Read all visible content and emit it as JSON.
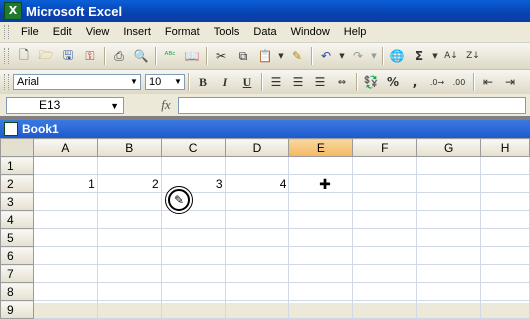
{
  "window": {
    "title": "Microsoft Excel",
    "app_icon": "excel-icon"
  },
  "menu": [
    "File",
    "Edit",
    "View",
    "Insert",
    "Format",
    "Tools",
    "Data",
    "Window",
    "Help"
  ],
  "toolbar_standard": [
    "new-icon",
    "open-icon",
    "save-icon",
    "permission-icon",
    "print-icon",
    "print-preview-icon",
    "spelling-icon",
    "cut-icon",
    "copy-icon",
    "paste-icon",
    "format-painter-icon",
    "undo-icon",
    "redo-icon",
    "hyperlink-icon",
    "autosum-icon",
    "sort-ascending-icon"
  ],
  "toolbar_formatting": {
    "font": "Arial",
    "size": "10",
    "buttons": [
      "bold-icon",
      "italic-icon",
      "underline-icon",
      "align-left-icon",
      "center-icon",
      "align-right-icon",
      "merge-center-icon",
      "currency-icon",
      "percent-icon",
      "comma-icon",
      "increase-decimal-icon",
      "decrease-indent-icon",
      "increase-indent-icon"
    ]
  },
  "formula_bar": {
    "name_box": "E13",
    "fx": "fx",
    "formula": ""
  },
  "workbook": {
    "title": "Book1"
  },
  "sheet": {
    "columns": [
      "A",
      "B",
      "C",
      "D",
      "E",
      "F",
      "G",
      "H"
    ],
    "selected_column": "E",
    "rows": [
      {
        "num": "1",
        "cells": [
          "",
          "",
          "",
          "",
          "",
          "",
          "",
          ""
        ]
      },
      {
        "num": "2",
        "cells": [
          "1",
          "2",
          "3",
          "4",
          "",
          "",
          "",
          ""
        ]
      },
      {
        "num": "3",
        "cells": [
          "",
          "",
          "",
          "",
          "",
          "",
          "",
          ""
        ]
      },
      {
        "num": "4",
        "cells": [
          "",
          "",
          "",
          "",
          "",
          "",
          "",
          ""
        ]
      },
      {
        "num": "5",
        "cells": [
          "",
          "",
          "",
          "",
          "",
          "",
          "",
          ""
        ]
      },
      {
        "num": "6",
        "cells": [
          "",
          "",
          "",
          "",
          "",
          "",
          "",
          ""
        ]
      },
      {
        "num": "7",
        "cells": [
          "",
          "",
          "",
          "",
          "",
          "",
          "",
          ""
        ]
      },
      {
        "num": "8",
        "cells": [
          "",
          "",
          "",
          "",
          "",
          "",
          "",
          ""
        ]
      },
      {
        "num": "9",
        "cells": [
          "",
          "",
          "",
          "",
          "",
          "",
          "",
          ""
        ]
      }
    ]
  },
  "overlay_icons": [
    "cell-cursor-icon",
    "busy-pencil-icon"
  ]
}
